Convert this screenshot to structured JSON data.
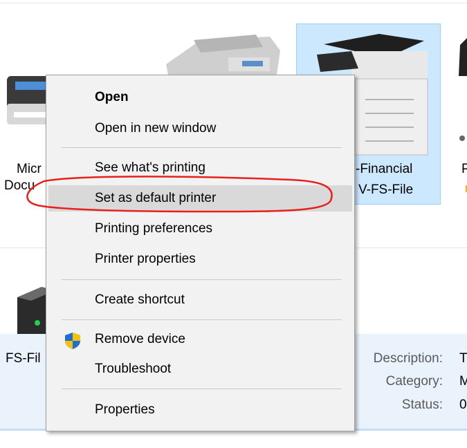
{
  "devices": [
    {
      "name": "micro-printer",
      "label_lines": [
        "Micr",
        "Docu"
      ]
    },
    {
      "name": "office-mfp",
      "label_lines": []
    },
    {
      "name": "financial-printer",
      "label_lines": [
        "-Financial",
        "V-FS-File"
      ]
    },
    {
      "name": "partial-device",
      "label_lines": [
        "P"
      ]
    }
  ],
  "second_section": {
    "device_label": "FS-Fil"
  },
  "details": {
    "description_label": "Description:",
    "description_value": "T",
    "category_label": "Category:",
    "category_value": "M",
    "status_label": "Status:",
    "status_value": "0"
  },
  "context_menu": {
    "items": [
      {
        "label": "Open",
        "bold": true
      },
      {
        "label": "Open in new window"
      },
      {
        "label": "See what's printing"
      },
      {
        "label": "Set as default printer",
        "highlighted": true
      },
      {
        "label": "Printing preferences"
      },
      {
        "label": "Printer properties"
      },
      {
        "label": "Create shortcut"
      },
      {
        "label": "Remove device",
        "icon": "uac-shield-icon"
      },
      {
        "label": "Troubleshoot"
      },
      {
        "label": "Properties"
      }
    ]
  },
  "annotation": {
    "color": "#e8201a",
    "shape": "hand-drawn-ellipse"
  }
}
